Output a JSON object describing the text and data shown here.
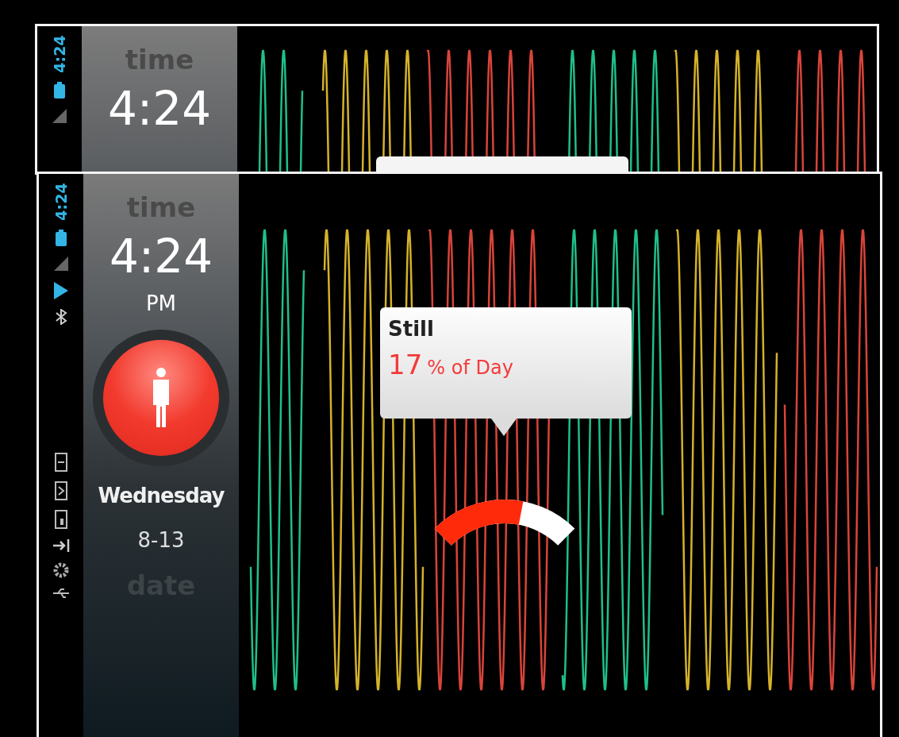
{
  "top_window": {
    "status_time": "4:24",
    "time_label": "time",
    "time": "4:24"
  },
  "main_window": {
    "status_time": "4:24",
    "time_label": "time",
    "time": "4:24",
    "ampm": "PM",
    "weekday": "Wednesday",
    "date": "8-13",
    "date_label": "date",
    "tooltip": {
      "title": "Still",
      "value": "17",
      "unit": "% of Day"
    },
    "gauge": {
      "level": 0.62
    }
  }
}
